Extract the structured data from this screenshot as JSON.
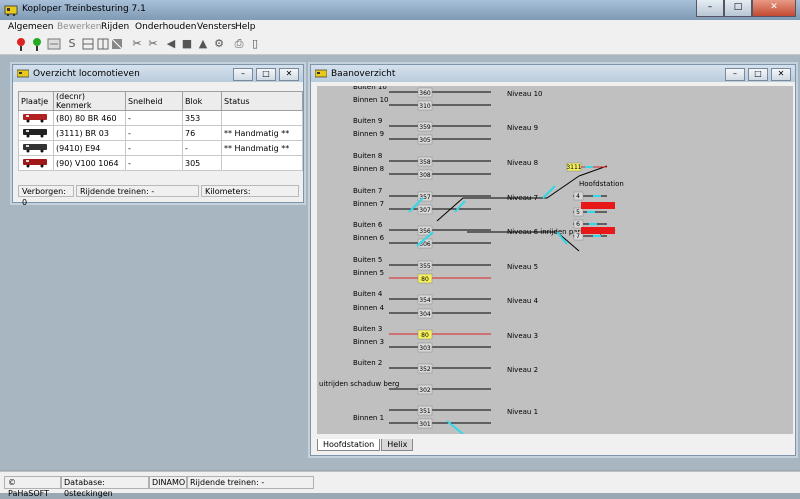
{
  "app": {
    "title": "Koploper Treinbesturing 7.1"
  },
  "window_controls": {
    "minimize": "–",
    "maximize": "□",
    "close": "✕"
  },
  "menu": [
    {
      "label": "Algemeen",
      "disabled": false
    },
    {
      "label": "Bewerken",
      "disabled": true
    },
    {
      "label": "Rijden",
      "disabled": false
    },
    {
      "label": "Onderhouden",
      "disabled": false
    },
    {
      "label": "Vensters",
      "disabled": false
    },
    {
      "label": "Help",
      "disabled": false
    }
  ],
  "toolbar_icons": [
    "signal-red-icon",
    "signal-green-icon",
    "mode-icon",
    "speed-s-icon",
    "grid-icon",
    "grid2-icon",
    "block-icon",
    "cut-icon",
    "cut2-icon",
    "speaker-icon",
    "train-icon",
    "train2-icon",
    "wrench-icon",
    "print-icon",
    "page-icon"
  ],
  "locos_window": {
    "title": "Overzicht locomotieven",
    "columns": [
      "Plaatje",
      "(decnr) Kenmerk",
      "Snelheid",
      "Blok",
      "Status"
    ],
    "rows": [
      {
        "kenmerk": "(80) 80 BR 460",
        "snelheid": "-",
        "blok": "353",
        "status": "",
        "color": "#b22222"
      },
      {
        "kenmerk": "(3111) BR 03",
        "snelheid": "-",
        "blok": "76",
        "status": "** Handmatig **",
        "color": "#222222"
      },
      {
        "kenmerk": "(9410) E94",
        "snelheid": "-",
        "blok": "-",
        "status": "** Handmatig **",
        "color": "#333333"
      },
      {
        "kenmerk": "(90) V100 1064",
        "snelheid": "-",
        "blok": "305",
        "status": "",
        "color": "#a01818"
      }
    ],
    "status": {
      "hidden": "Verborgen: 0",
      "driving": "Rijdende treinen: -",
      "km": "Kilometers:"
    }
  },
  "track_window": {
    "title": "Baanoverzicht",
    "tabs": [
      "Hoofdstation",
      "Helix"
    ],
    "rows": [
      {
        "left": "Buiten 10",
        "block": "360",
        "level": "Niveau 10"
      },
      {
        "left": "Binnen 10",
        "block": "310",
        "level": ""
      },
      {
        "left": "Buiten 9",
        "block": "359",
        "level": "Niveau 9"
      },
      {
        "left": "Binnen 9",
        "block": "305",
        "level": ""
      },
      {
        "left": "Buiten 8",
        "block": "358",
        "level": "Niveau 8"
      },
      {
        "left": "Binnen 8",
        "block": "308",
        "level": ""
      },
      {
        "left": "Buiten 7",
        "block": "357",
        "level": "Niveau 7"
      },
      {
        "left": "Binnen 7",
        "block": "307",
        "level": ""
      },
      {
        "left": "Buiten 6",
        "block": "356",
        "level": "Niveau 6 inrijden parkeerspoor"
      },
      {
        "left": "Binnen 6",
        "block": "306",
        "level": ""
      },
      {
        "left": "Buiten 5",
        "block": "355",
        "level": "Niveau 5"
      },
      {
        "left": "Binnen 5",
        "block": "80",
        "level": ""
      },
      {
        "left": "Buiten 4",
        "block": "354",
        "level": "Niveau 4"
      },
      {
        "left": "Binnen 4",
        "block": "304",
        "level": ""
      },
      {
        "left": "Buiten 3",
        "block": "80",
        "level": "Niveau 3"
      },
      {
        "left": "Binnen 3",
        "block": "303",
        "level": ""
      },
      {
        "left": "Buiten 2",
        "block": "352",
        "level": "Niveau 2"
      },
      {
        "left": "uitrijden schaduw berg",
        "block": "302",
        "level": ""
      },
      {
        "left": "",
        "block": "351",
        "level": "Niveau 1"
      },
      {
        "left": "Binnen 1",
        "block": "301",
        "level": ""
      }
    ],
    "station_label": "Hoofdstation",
    "station_block": "3111",
    "station_tracks": [
      "4",
      "5",
      "6",
      "7"
    ]
  },
  "statusbar": [
    "© PaHaSOFT",
    "Database: 0steckingen",
    "DINAMO",
    "Rijdende treinen: -"
  ]
}
